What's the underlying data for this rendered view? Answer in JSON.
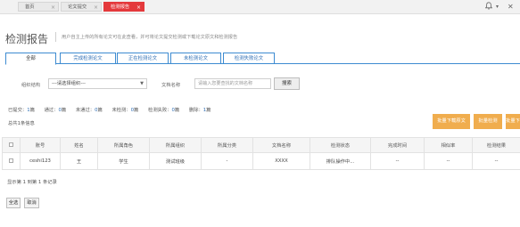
{
  "topbar": {
    "tabs": [
      {
        "label": "首页",
        "close": "×"
      },
      {
        "label": "论文提交",
        "close": "×"
      },
      {
        "label": "检测报告",
        "close": "×"
      }
    ],
    "icons": [
      "bell-icon",
      "chevron-down-icon",
      "close-icon"
    ]
  },
  "header": {
    "title": "检测报告",
    "description": "用户自主上传的所有论文可在此查看，并可将论文提交检测或下载论文原文和检测报告"
  },
  "subtabs": [
    "全部",
    "完成检测论文",
    "正在检测论文",
    "未检测论文",
    "检测失败论文"
  ],
  "filters": {
    "org_label": "组织结构",
    "org_value": "---请选择组织---",
    "doc_label": "文档名称",
    "doc_placeholder": "请输入您要查找的文档名称",
    "search_label": "搜索"
  },
  "stats": [
    {
      "label": "已提交：",
      "value": "1",
      "unit": "篇"
    },
    {
      "label": "通过：",
      "value": "0",
      "unit": "篇"
    },
    {
      "label": "未通过：",
      "value": "0",
      "unit": "篇"
    },
    {
      "label": "未检测：",
      "value": "0",
      "unit": "篇"
    },
    {
      "label": "检测失败：",
      "value": "0",
      "unit": "篇"
    },
    {
      "label": "删除：",
      "value": "1",
      "unit": "篇"
    }
  ],
  "total_info": "总共1条信息",
  "actions": [
    "批量下载原文",
    "批量检测",
    "批量下"
  ],
  "table": {
    "columns": [
      "",
      "账号",
      "姓名",
      "所属角色",
      "所属组织",
      "所属分类",
      "文档名称",
      "检测状态",
      "完成时间",
      "相似率",
      "检测结果"
    ],
    "rows": [
      [
        "",
        "ceshi123",
        "王",
        "学生",
        "测试班级",
        "-",
        "XXXX",
        "排队操作中...",
        "--",
        "--",
        "--"
      ]
    ]
  },
  "page_info": "显示第 1 到第 1 条记录",
  "footer": {
    "select_all": "全选",
    "cancel": "取消"
  },
  "colors": {
    "accent_red": "#e4393c",
    "tab_blue": "#3d8bd1",
    "action_orange": "#f0ad4e",
    "status_orange": "#f08c1a"
  }
}
